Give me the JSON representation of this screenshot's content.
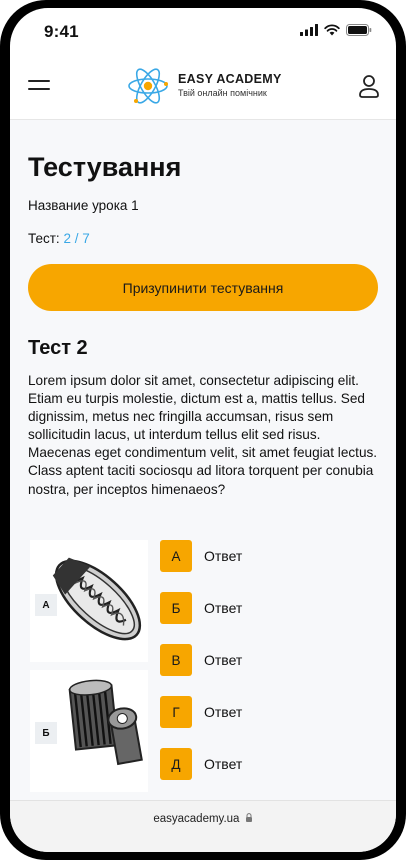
{
  "status": {
    "time": "9:41"
  },
  "brand": {
    "title": "EASY ACADEMY",
    "subtitle": "Твій онлайн помічник"
  },
  "page": {
    "title": "Тестування",
    "lesson_name": "Название урока 1",
    "test_label": "Тест:",
    "progress": "2 / 7"
  },
  "pause_button": {
    "label": "Призупинити тестування"
  },
  "test": {
    "title": "Тест 2",
    "question": "Lorem ipsum dolor sit amet, consectetur adipiscing elit. Etiam eu turpis molestie, dictum est a, mattis tellus. Sed dignissim, metus nec fringilla accumsan, risus sem sollicitudin lacus, ut interdum tellus elit sed risus. Maecenas eget condimentum velit, sit amet feugiat lectus. Class aptent taciti sociosqu ad litora torquent per conubia nostra, per inceptos himenaeos?"
  },
  "images": [
    {
      "label": "А"
    },
    {
      "label": "Б"
    }
  ],
  "answers": [
    {
      "letter": "А",
      "text": "Ответ"
    },
    {
      "letter": "Б",
      "text": "Ответ"
    },
    {
      "letter": "В",
      "text": "Ответ"
    },
    {
      "letter": "Г",
      "text": "Ответ"
    },
    {
      "letter": "Д",
      "text": "Ответ"
    }
  ],
  "browser": {
    "url": "easyacademy.ua"
  },
  "colors": {
    "accent": "#f7a600",
    "link": "#3aa8e6",
    "logo_blue": "#3aa8e6",
    "logo_orange": "#f7a600"
  }
}
